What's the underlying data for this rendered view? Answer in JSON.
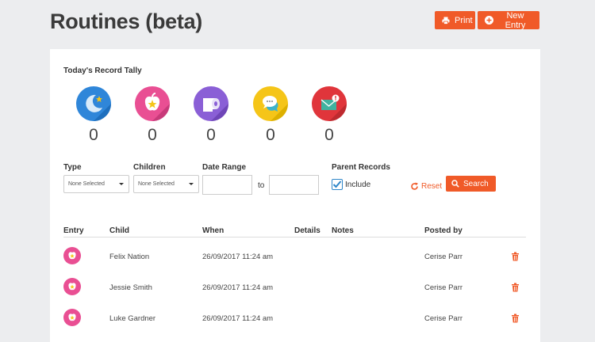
{
  "header": {
    "title": "Routines (beta)",
    "print_label": "Print",
    "new_entry_label": "New Entry"
  },
  "tally": {
    "title": "Today's Record Tally",
    "items": [
      {
        "icon": "sleep-icon",
        "color": "#2f86d9",
        "count": "0"
      },
      {
        "icon": "food-icon",
        "color": "#e94f93",
        "count": "0"
      },
      {
        "icon": "toilet-paper-icon",
        "color": "#8a5fd6",
        "count": "0"
      },
      {
        "icon": "chat-icon",
        "color": "#f5c518",
        "count": "0"
      },
      {
        "icon": "mail-alert-icon",
        "color": "#e0353b",
        "count": "0"
      }
    ]
  },
  "filters": {
    "type_label": "Type",
    "type_value": "None Selected",
    "children_label": "Children",
    "children_value": "None Selected",
    "date_range_label": "Date Range",
    "to_label": "to",
    "parent_records_label": "Parent Records",
    "include_label": "Include",
    "include_checked": true,
    "reset_label": "Reset",
    "search_label": "Search"
  },
  "table": {
    "headers": [
      "Entry",
      "Child",
      "When",
      "Details",
      "Notes",
      "Posted by"
    ],
    "rows": [
      {
        "entry_icon": "food-icon",
        "child": "Felix Nation",
        "when": "26/09/2017 11:24 am",
        "details": "",
        "notes": "",
        "posted_by": "Cerise Parr"
      },
      {
        "entry_icon": "food-icon",
        "child": "Jessie Smith",
        "when": "26/09/2017 11:24 am",
        "details": "",
        "notes": "",
        "posted_by": "Cerise Parr"
      },
      {
        "entry_icon": "food-icon",
        "child": "Luke Gardner",
        "when": "26/09/2017 11:24 am",
        "details": "",
        "notes": "",
        "posted_by": "Cerise Parr"
      }
    ]
  },
  "colors": {
    "accent": "#f05a28",
    "background": "#ecedef",
    "checkbox": "#2e86c9"
  }
}
